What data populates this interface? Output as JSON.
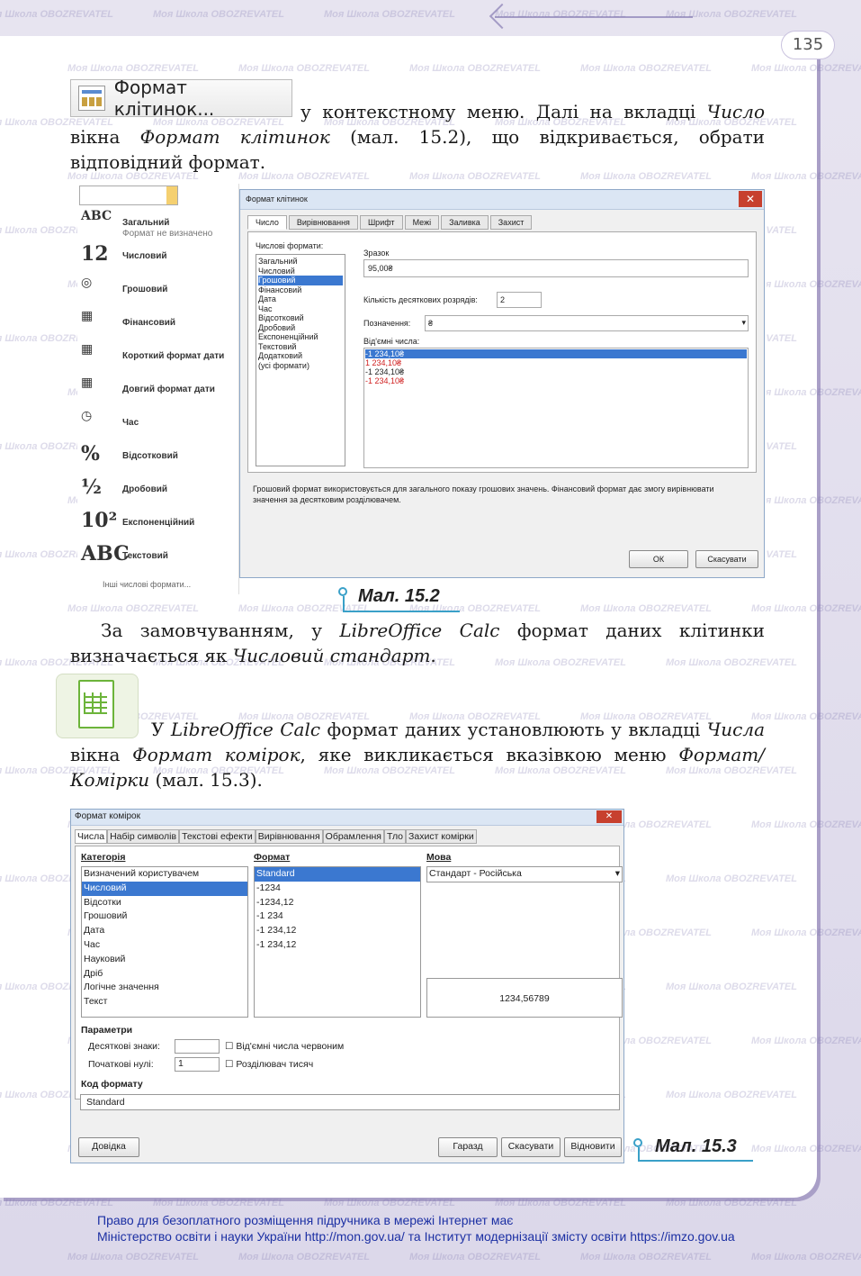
{
  "page_number": "135",
  "format_button_label": "Формат клітинок...",
  "para1": {
    "part1": " у контекстному меню. Далі на вкладці ",
    "italic1": "Число",
    "part2": " вікна ",
    "italic2": "Формат клітинок",
    "part3": " (мал. 15.2), що відкривається, обрати відповідний формат."
  },
  "fig1": {
    "caption": "Мал. 15.2",
    "left_list": [
      {
        "icon": "ABC 123",
        "label": "Загальний",
        "sub": "Формат не визначено"
      },
      {
        "icon": "12",
        "label": "Числовий"
      },
      {
        "icon": "coins-icon",
        "label": "Грошовий"
      },
      {
        "icon": "finance-icon",
        "label": "Фінансовий"
      },
      {
        "icon": "calendar-icon",
        "label": "Короткий формат дати"
      },
      {
        "icon": "calendar-icon",
        "label": "Довгий формат дати"
      },
      {
        "icon": "clock-icon",
        "label": "Час"
      },
      {
        "icon": "%",
        "label": "Відсотковий"
      },
      {
        "icon": "½",
        "label": "Дробовий"
      },
      {
        "icon": "10²",
        "label": "Експоненційний"
      },
      {
        "icon": "ABC",
        "label": "Текстовий"
      }
    ],
    "more_formats": "Інші числові формати...",
    "dialog_title": "Формат клітинок",
    "tabs": [
      "Число",
      "Вирівнювання",
      "Шрифт",
      "Межі",
      "Заливка",
      "Захист"
    ],
    "numeric_formats_label": "Числові формати:",
    "categories": [
      "Загальний",
      "Числовий",
      "Грошовий",
      "Фінансовий",
      "Дата",
      "Час",
      "Відсотковий",
      "Дробовий",
      "Експоненційний",
      "Текстовий",
      "Додатковий",
      "(усі формати)"
    ],
    "sample_label": "Зразок",
    "sample_value": "95,00₴",
    "decimals_label": "Кількість десяткових розрядів:",
    "decimals_value": "2",
    "symbol_label": "Позначення:",
    "symbol_value": "₴",
    "negative_label": "Від'ємні числа:",
    "negatives": [
      "-1 234,10₴",
      "1 234,10₴",
      "-1 234,10₴",
      "-1 234,10₴"
    ],
    "description": "Грошовий формат використовується для загального показу грошових значень. Фінансовий формат дає змогу вирівнювати значення за десятковим розділювачем.",
    "ok": "ОК",
    "cancel": "Скасувати"
  },
  "para2": {
    "part1": "За замовчуванням, у ",
    "italic1": "LibreOffice Calc",
    "part2": " формат даних клітинки визначається як ",
    "italic2": "Числовий стандарт",
    "part3": "."
  },
  "para3": {
    "part1": "У ",
    "italic1": "LibreOffice Calc",
    "part2": " формат даних установлюють у вкладці ",
    "italic2": "Числа",
    "part3": " вікна ",
    "italic3": "Формат комірок",
    "part4": ", яке викликається вказівкою меню ",
    "italic4": "Формат/Комірки",
    "part5": " (мал. 15.3)."
  },
  "fig2": {
    "caption": "Мал. 15.3",
    "dialog_title": "Формат комірок",
    "tabs": [
      "Числа",
      "Набір символів",
      "Текстові ефекти",
      "Вирівнювання",
      "Обрамлення",
      "Тло",
      "Захист комірки"
    ],
    "category_header": "Категорія",
    "categories": [
      "Визначений користувачем",
      "Числовий",
      "Відсотки",
      "Грошовий",
      "Дата",
      "Час",
      "Науковий",
      "Дріб",
      "Логічне значення",
      "Текст"
    ],
    "format_header": "Формат",
    "formats": [
      "Standard",
      "-1234",
      "-1234,12",
      "-1 234",
      "-1 234,12",
      "-1 234,12"
    ],
    "language_header": "Мова",
    "language_value": "Стандарт - Російська",
    "preview_value": "1234,56789",
    "params_header": "Параметри",
    "decimals_label": "Десяткові знаки:",
    "leading_zeros_label": "Початкові нулі:",
    "leading_zeros_value": "1",
    "neg_red_label": "Від'ємні числа червоним",
    "thousands_label": "Розділювач тисяч",
    "format_code_header": "Код формату",
    "format_code_value": "Standard",
    "help": "Довідка",
    "ok": "Гаразд",
    "cancel": "Скасувати",
    "reset": "Відновити"
  },
  "footer": {
    "line1": "Право для безоплатного розміщення підручника в мережі Інтернет має",
    "line2": "Міністерство освіти і науки України http://mon.gov.ua/ та Інститут модернізації змісту освіти https://imzo.gov.ua"
  },
  "watermark": "Моя Школа  OBOZREVATEL",
  "colors": {
    "accent": "#3aa0c8",
    "frame": "#a99fc7",
    "selection": "#3b78d0",
    "footer_link": "#1b2fa3"
  }
}
